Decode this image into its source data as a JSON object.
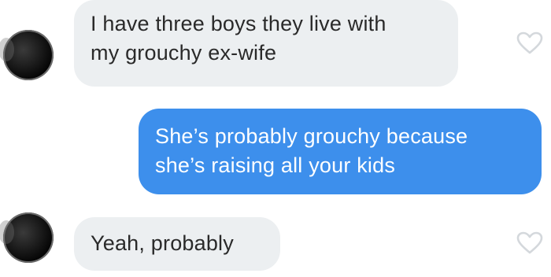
{
  "messages": [
    {
      "sender": "them",
      "lines": [
        "I have three boys they live with",
        "my grouchy ex-wife"
      ],
      "icon": "heart-outline-icon"
    },
    {
      "sender": "me",
      "lines": [
        "She’s probably grouchy because",
        "she’s raising all your kids"
      ]
    },
    {
      "sender": "them",
      "lines": [
        "Yeah, probably"
      ],
      "icon": "heart-outline-icon"
    }
  ],
  "colors": {
    "incoming_bubble": "#eceff1",
    "outgoing_bubble": "#3d8fec",
    "heart_outline": "#d4d8dc"
  }
}
